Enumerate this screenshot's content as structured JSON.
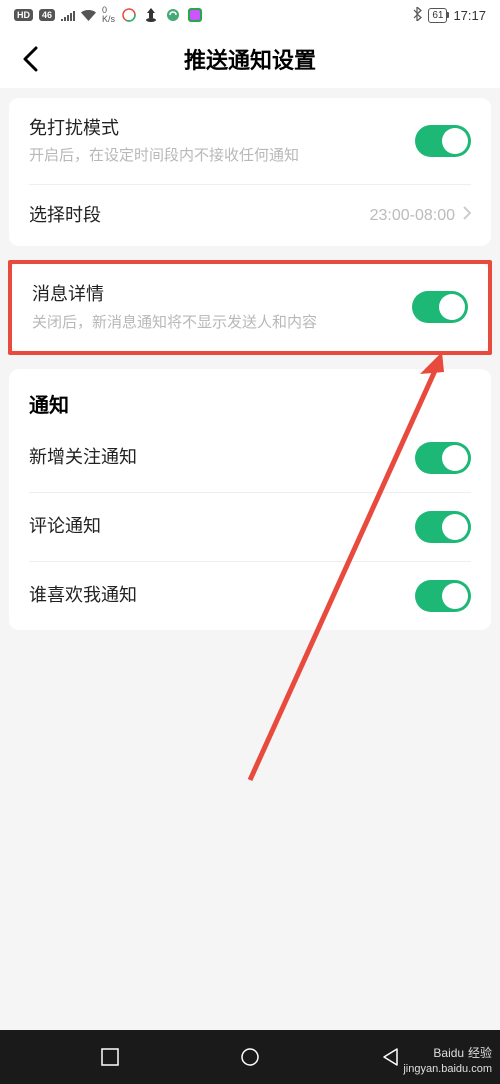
{
  "status_bar": {
    "hd_badge": "HD",
    "network_badge": "46",
    "speed": "0\nK/s",
    "bluetooth": "✱",
    "battery": "61",
    "time": "17:17"
  },
  "header": {
    "title": "推送通知设置"
  },
  "section1": {
    "dnd": {
      "title": "免打扰模式",
      "subtitle": "开启后，在设定时间段内不接收任何通知",
      "enabled": true
    },
    "time_range": {
      "title": "选择时段",
      "value": "23:00-08:00"
    }
  },
  "section2": {
    "message_detail": {
      "title": "消息详情",
      "subtitle": "关闭后，新消息通知将不显示发送人和内容",
      "enabled": true
    }
  },
  "section3": {
    "header": "通知",
    "items": [
      {
        "title": "新增关注通知",
        "enabled": true
      },
      {
        "title": "评论通知",
        "enabled": true
      },
      {
        "title": "谁喜欢我通知",
        "enabled": true
      }
    ]
  },
  "watermark": {
    "brand": "Baidu",
    "suffix": "经验",
    "url": "jingyan.baidu.com"
  }
}
